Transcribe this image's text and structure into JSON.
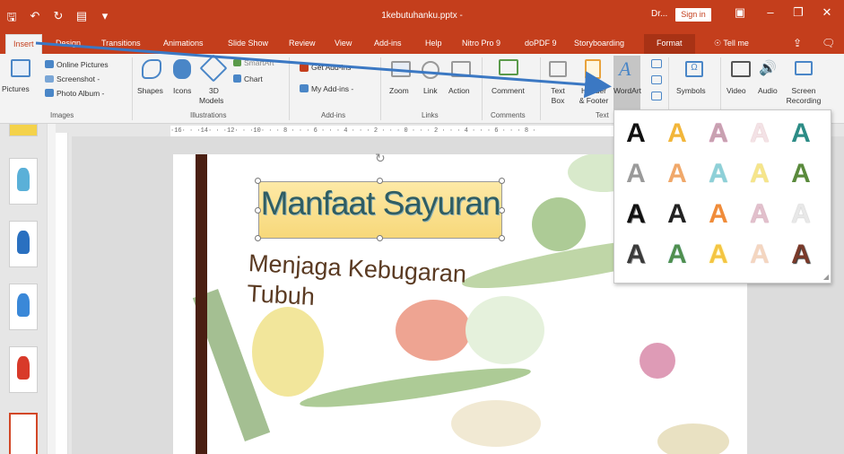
{
  "window": {
    "doc_title": "1kebutuhanku.pptx -",
    "account_short": "Dr...",
    "sign_in": "Sign in"
  },
  "qat": [
    "save-icon",
    "undo-icon",
    "redo-icon",
    "present-icon",
    "customize-icon"
  ],
  "tabs": {
    "insert": "Insert",
    "design": "Design",
    "transitions": "Transitions",
    "animations": "Animations",
    "slideshow": "Slide Show",
    "review": "Review",
    "view": "View",
    "addins": "Add-ins",
    "help": "Help",
    "nitro": "Nitro Pro 9",
    "dopdf": "doPDF 9",
    "storyboarding": "Storyboarding",
    "format": "Format",
    "tellme": "Tell me"
  },
  "ribbon": {
    "pictures": "Pictures",
    "online_pictures": "Online Pictures",
    "screenshot": "Screenshot -",
    "photo_album": "Photo Album -",
    "images_group": "Images",
    "shapes": "Shapes",
    "icons": "Icons",
    "models_3d": "3D",
    "models_3d_2": "Models",
    "smartart": "SmartArt",
    "chart": "Chart",
    "illustrations_group": "Illustrations",
    "get_addins": "Get Add-ins",
    "my_addins": "My Add-ins -",
    "addins_group": "Add-ins",
    "zoom": "Zoom",
    "link": "Link",
    "action": "Action",
    "links_group": "Links",
    "comment": "Comment",
    "comments_group": "Comments",
    "text_box_1": "Text",
    "text_box_2": "Box",
    "header_1": "Header",
    "header_2": "& Footer",
    "wordart": "WordArt",
    "text_group": "Text",
    "symbols": "Symbols",
    "video": "Video",
    "audio": "Audio",
    "screen_rec_1": "Screen",
    "screen_rec_2": "Recording"
  },
  "ruler": "·16· · ·14· · ·12· · ·10· · · 8 · · · 6 · · · 4 · · · 2 · · · 0 · · · 2 · · · 4 · · · 6 · · · 8 ·",
  "slide": {
    "title": "Manfaat Sayuran",
    "subtitle_line1": "Menjaga Kebugaran",
    "subtitle_line2": "Tubuh"
  },
  "wordart_gallery": {
    "glyph": "A",
    "styles": [
      {
        "color": "#111111",
        "shadow": "none"
      },
      {
        "color": "#f2b63a",
        "shadow": "none"
      },
      {
        "color": "#c7a2b0",
        "shadow": "0 0 1px #a06"
      },
      {
        "color": "#f3e2e6",
        "shadow": "0 0 1px #c88"
      },
      {
        "color": "#2c8c86",
        "shadow": "none"
      },
      {
        "color": "#9a9a9a",
        "shadow": "none"
      },
      {
        "color": "#f0a86a",
        "shadow": "none"
      },
      {
        "color": "#8ed0d8",
        "shadow": "0 0 1px #4aa"
      },
      {
        "color": "#f6e58a",
        "shadow": "0 0 1px #cb4"
      },
      {
        "color": "#5a8a3c",
        "shadow": "none"
      },
      {
        "color": "#111111",
        "shadow": "1px 1px 0 #888"
      },
      {
        "color": "#222222",
        "shadow": "none"
      },
      {
        "color": "#f08c3a",
        "shadow": "none"
      },
      {
        "color": "#e2c0cc",
        "shadow": "0 0 1px #946"
      },
      {
        "color": "#e8e8e8",
        "shadow": "0 0 1px #999"
      },
      {
        "color": "#3a3a3a",
        "shadow": "1px 1px 0 #999"
      },
      {
        "color": "#4f8f4f",
        "shadow": "0 0 2px #bde"
      },
      {
        "color": "#f4c542",
        "shadow": "0 0 2px #fe8"
      },
      {
        "color": "#f4d6c0",
        "shadow": "0 0 1px #dbb"
      },
      {
        "color": "#7a3a2a",
        "shadow": "1px 1px 1px #333"
      }
    ]
  },
  "colors": {
    "accent": "#c43e1c",
    "annotation_arrow": "#3b78c3"
  }
}
